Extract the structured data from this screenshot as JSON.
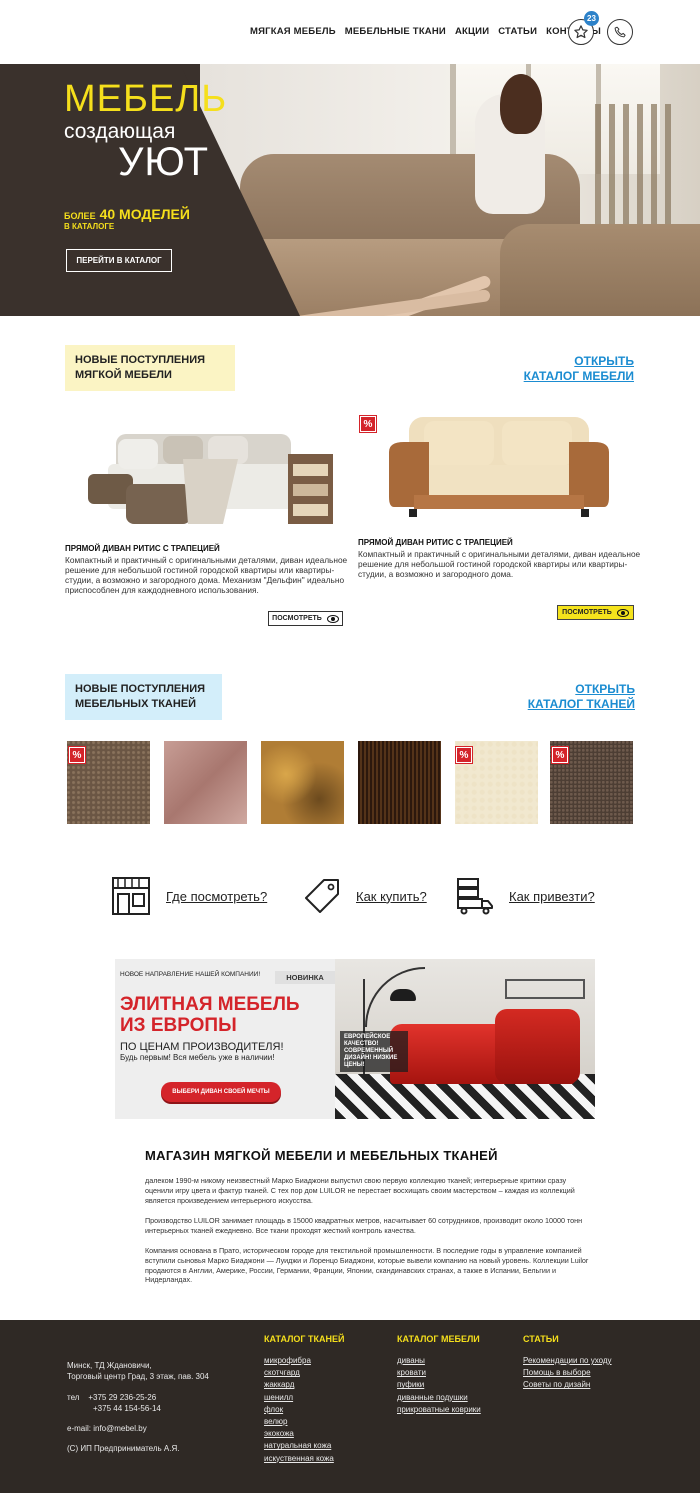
{
  "header": {
    "nav": [
      "Мягкая мебель",
      "Мебельные ткани",
      "Акции",
      "Статьи",
      "Контакты"
    ],
    "favorites_count": "23"
  },
  "hero": {
    "title_line1": "МЕБЕЛЬ",
    "title_line2": "создающая",
    "title_line3": "УЮТ",
    "count_prefix": "более",
    "count_value": "40 моделей",
    "count_suffix": "в каталоге",
    "button": "Перейти в каталог"
  },
  "furniture_section": {
    "label_line1": "Новые поступления",
    "label_line2": "мягкой мебели",
    "link_line1": "Открыть",
    "link_line2": "каталог мебели",
    "products": [
      {
        "title": "Прямой диван Ритис с трапецией",
        "description": "Компактный и практичный с оригинальными деталями, диван идеальное решение для небольшой гостиной городской квартиры или квартиры-студии, а возможно и загородного дома. Механизм \"Дельфин\" идеально приспособлен для каждодневного использования.",
        "button": "посмотреть",
        "sale": false
      },
      {
        "title": "Прямой диван Ритис с трапецией",
        "description": "Компактный и практичный с оригинальными деталями, диван идеальное решение для небольшой гостиной городской квартиры или квартиры-студии, а возможно и загородного дома.",
        "button": "посмотреть",
        "sale": true
      }
    ]
  },
  "fabric_section": {
    "label_line1": "Новые поступления",
    "label_line2": "мебельных тканей",
    "link_line1": "Открыть",
    "link_line2": "каталог тканей",
    "sale_badge": "%"
  },
  "info": {
    "where": "Где посмотреть?",
    "how_buy": "Как купить?",
    "how_deliver": "Как привезти?"
  },
  "promo": {
    "top_text": "Новое направление нашей компании!",
    "badge": "Новинка",
    "headline_line1": "Элитная мебель",
    "headline_line2": "из Европы",
    "sub1": "по ценам производителя!",
    "sub2": "Будь первым! Вся мебель уже в наличии!",
    "button": "Выбери диван своей мечты",
    "note": "Европейское качество! Современный дизайн! Низкие цены!"
  },
  "about": {
    "title": "Магазин мягкой мебели и мебельных тканей",
    "p1": " далеком 1990-м никому неизвестный Марко Биаджони  выпустил свою первую коллекцию тканей; интерьерные критики сразу оценили игру цвета и фактур тканей. С тех пор дом LUILOR  не перестает восхищать своим мастерством – каждая из коллекций является произведением интерьерного искусства.",
    "p2": "Производство LUILOR занимает площадь в 15000 квадратных метров, насчитывает 60 сотрудников, производит около 10000 тонн интерьерных  тканей ежедневно. Все ткани проходят жесткий контроль качества.",
    "p3": "Компания основана в Прато, историческом городе для текстильной промышленности. В последние годы в управление компанией вступили сыновья Марко Биаджони — Луиджи и Лоренцо Биаджони, которые  вывели компанию на новый уровень. Коллекции Luilor продаются в Англии, Америке, России, Германии, Франции, Японии, скандинавских странах, а также в Испании, Бельгии и Нидерландах."
  },
  "footer": {
    "address1": "Минск, ТД Ждановичи,",
    "address2": "Торговый центр Град, 3 этаж, пав. 304",
    "phone_label": "тел",
    "phone1": "+375 29 236-25-26",
    "phone2": "+375 44 154-56-14",
    "email": "e-mail: info@mebel.by",
    "copyright": "(С) ИП Предприниматель А.Я.",
    "col1_title": "Каталог тканей",
    "col1_links": [
      "микрофибра",
      "скотчгард",
      "жаккард",
      "шенилл",
      "флок",
      "велюр",
      "экокожа",
      "натуральная кожа",
      "искуственная кожа"
    ],
    "col2_title": "Каталог мебели",
    "col2_links": [
      "диваны",
      "кровати",
      "пуфики",
      "диванные подушки",
      "прикроватные коврики"
    ],
    "col3_title": "Статьи",
    "col3_links": [
      "Рекомендации по уходу",
      "Помощь в выборе",
      "Советы по дизайн"
    ]
  },
  "colors": {
    "accent_yellow": "#f5df1c",
    "hero_bg": "#3a312c",
    "link_blue": "#1b8cd1",
    "sale_red": "#d4242a",
    "footer_bg": "#2f2925"
  }
}
